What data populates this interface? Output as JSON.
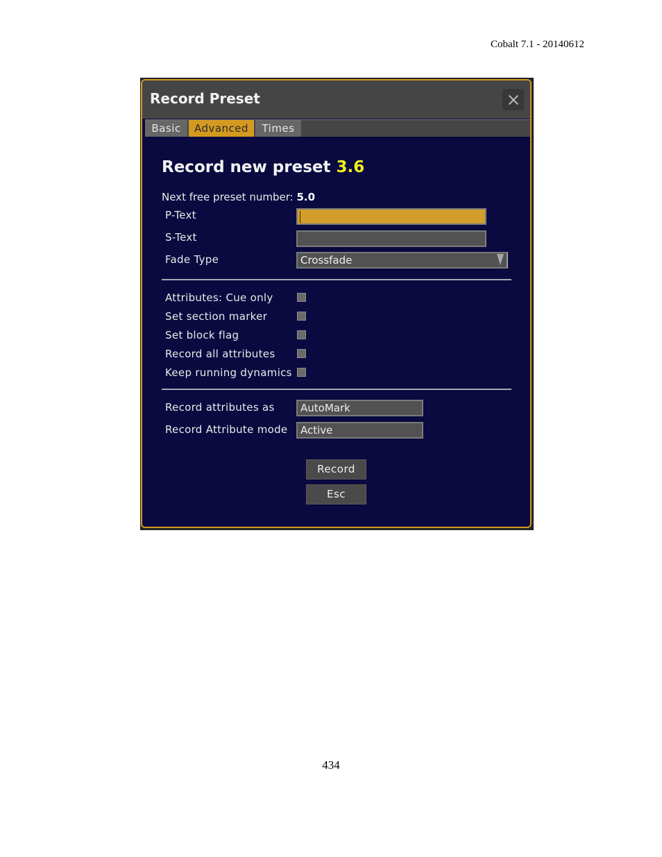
{
  "page": {
    "header": "Cobalt 7.1 - 20140612",
    "number": "434"
  },
  "dialog": {
    "title": "Record Preset",
    "tabs": [
      {
        "label": "Basic",
        "active": false
      },
      {
        "label": "Advanced",
        "active": true
      },
      {
        "label": "Times",
        "active": false
      }
    ],
    "heading_prefix": "Record new preset ",
    "heading_number": "3.6",
    "next_free_label": "Next free preset number: ",
    "next_free_value": "5.0",
    "fields": {
      "ptext": {
        "label": "P-Text",
        "value": ""
      },
      "stext": {
        "label": "S-Text",
        "value": ""
      },
      "fade_type": {
        "label": "Fade Type",
        "value": "Crossfade"
      }
    },
    "checkboxes": [
      {
        "label": "Attributes: Cue only",
        "checked": false
      },
      {
        "label": "Set section marker",
        "checked": false
      },
      {
        "label": "Set block flag",
        "checked": false
      },
      {
        "label": "Record all attributes",
        "checked": false
      },
      {
        "label": "Keep running dynamics",
        "checked": false
      }
    ],
    "record_as": {
      "label": "Record attributes as",
      "value": "AutoMark"
    },
    "record_mode": {
      "label": "Record Attribute mode",
      "value": "Active"
    },
    "buttons": {
      "record": "Record",
      "esc": "Esc"
    },
    "colors": {
      "accent": "#d49a20",
      "background": "#0a0a40",
      "highlight_number": "#f1ee1e"
    }
  }
}
